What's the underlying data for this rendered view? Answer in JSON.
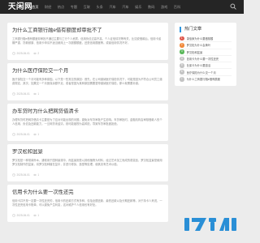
{
  "site": {
    "logo": "天闲网"
  },
  "nav": {
    "items": [
      "首页",
      "财经",
      "热点",
      "专题",
      "互联",
      "头条",
      "汽车",
      "汽车",
      "娱乐",
      "数码",
      "游戏",
      "百科"
    ],
    "active_index": 0
  },
  "articles": [
    {
      "title": "为什么工商银行融e借有额度却审批不了",
      "body": "工商银行融e借有额度却审批不通过主要与工行个人资质、信用负债过高不高、个人征信情况等有关，比如说借款后，信用卡逾期严重、贷款频繁、信用卡申请不适当使用上一次超额额度，还是信用额度等。或者信用情况不好。",
      "date": "2025-06-01",
      "views": "2"
    },
    {
      "title": "为什么医疗保险交一个月",
      "body": "医疗保险交一个月可能有多种原因。以下是一些常见的原因：首先，在公司缴纳医疗保险情况下，可能是因为不符合公司员工缴费规定，其次，如果交一个月医保余额不足，或者是因为某种原因需要暂停缴纳医疗保险，那么就需要补缴。",
      "date": "2025-06-01",
      "views": "1"
    },
    {
      "title": "办车贷时为什么把网贷借清卡",
      "body": "办理车贷时把网贷借清卡主要是为了应对可能出现的问题，避免对车贷审批产生影响。车贷审批时，金融机构会审核借款人的个人信用、负债及还款能力，一旦网贷未结清，则可能被视为高风险，导致车贷审批被拒绝。",
      "date": "2025-06-01",
      "views": "1"
    },
    {
      "title": "罗汉松和盆景",
      "body": "罗汉松是一种常绿乔木，通常用于园林景观中，而盆景则是以其他植物为材料，经过艺术加工而成的观赏品，罗汉松盆景是使用罗汉松制作的盆景，将罗汉松种植在盆中，并进行修剪、造型等处理，使其具有艺术价值。",
      "date": "2025-06-01",
      "views": "1"
    },
    {
      "title": "信用卡为什么要一次性还完",
      "body": "信用卡并不是一定要一次性还完的，信用卡的还款方式有多种，包括全额还款、最低还款以及分期还款等。对于持卡人来说，一次性还完信用卡账单，可以避免产生利息，这对维护个人信用也有好处。",
      "date": "2025-06-01",
      "views": "1"
    }
  ],
  "sidebar": {
    "title": "热门文章",
    "items": [
      {
        "num": "1",
        "label": "康佰家为什么要做核酸",
        "color": "#e05a4f"
      },
      {
        "num": "2",
        "label": "罗汉松为什么会黄叶",
        "color": "#f08a3c"
      },
      {
        "num": "3",
        "label": "罗汉松和盆景",
        "color": "#5cb85c"
      },
      {
        "num": "4",
        "label": "信用卡为什么要一次性还完",
        "color": "#c4c4c4"
      },
      {
        "num": "5",
        "label": "社保卡为什么要激活",
        "color": "#c4c4c4"
      },
      {
        "num": "6",
        "label": "医疗保险为什么交一个月",
        "color": "#c4c4c4"
      },
      {
        "num": "7",
        "label": "为什么工商银行融e借有额度",
        "color": "#c4c4c4"
      }
    ]
  },
  "colors": {
    "accent": "#2e96e0",
    "topbar": "#252525",
    "background": "#ececec"
  }
}
